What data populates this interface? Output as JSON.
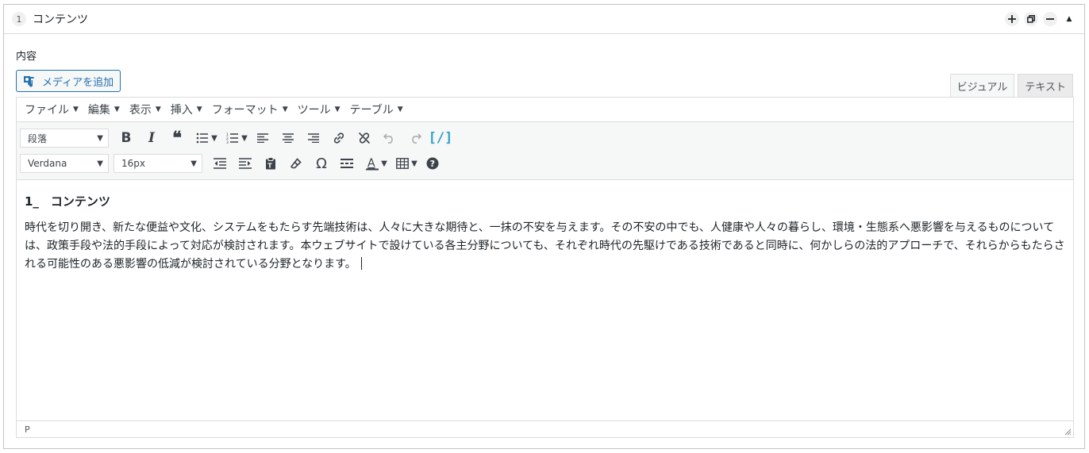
{
  "panel": {
    "number": "1",
    "title": "コンテンツ",
    "actions": [
      "add-icon",
      "duplicate-icon",
      "remove-icon",
      "collapse-icon"
    ]
  },
  "field": {
    "label": "内容",
    "media_button": "メディアを追加"
  },
  "tabs": [
    {
      "label": "ビジュアル",
      "active": true
    },
    {
      "label": "テキスト",
      "active": false
    }
  ],
  "menubar": [
    "ファイル",
    "編集",
    "表示",
    "挿入",
    "フォーマット",
    "ツール",
    "テーブル"
  ],
  "toolbar": {
    "format_select": "段落",
    "font_select": "Verdana",
    "size_select": "16px"
  },
  "content": {
    "heading": "1_　コンテンツ",
    "body": "時代を切り開き、新たな便益や文化、システムをもたらす先端技術は、人々に大きな期待と、一抹の不安を与えます。その不安の中でも、人健康や人々の暮らし、環境・生態系へ悪影響を与えるものについては、政策手段や法的手段によって対応が検討されます。本ウェブサイトで設けている各主分野についても、それぞれ時代の先駆けである技術であると同時に、何かしらの法的アプローチで、それらからもたらされる可能性のある悪影響の低減が検討されている分野となります。"
  },
  "statusbar": {
    "path": "P"
  }
}
